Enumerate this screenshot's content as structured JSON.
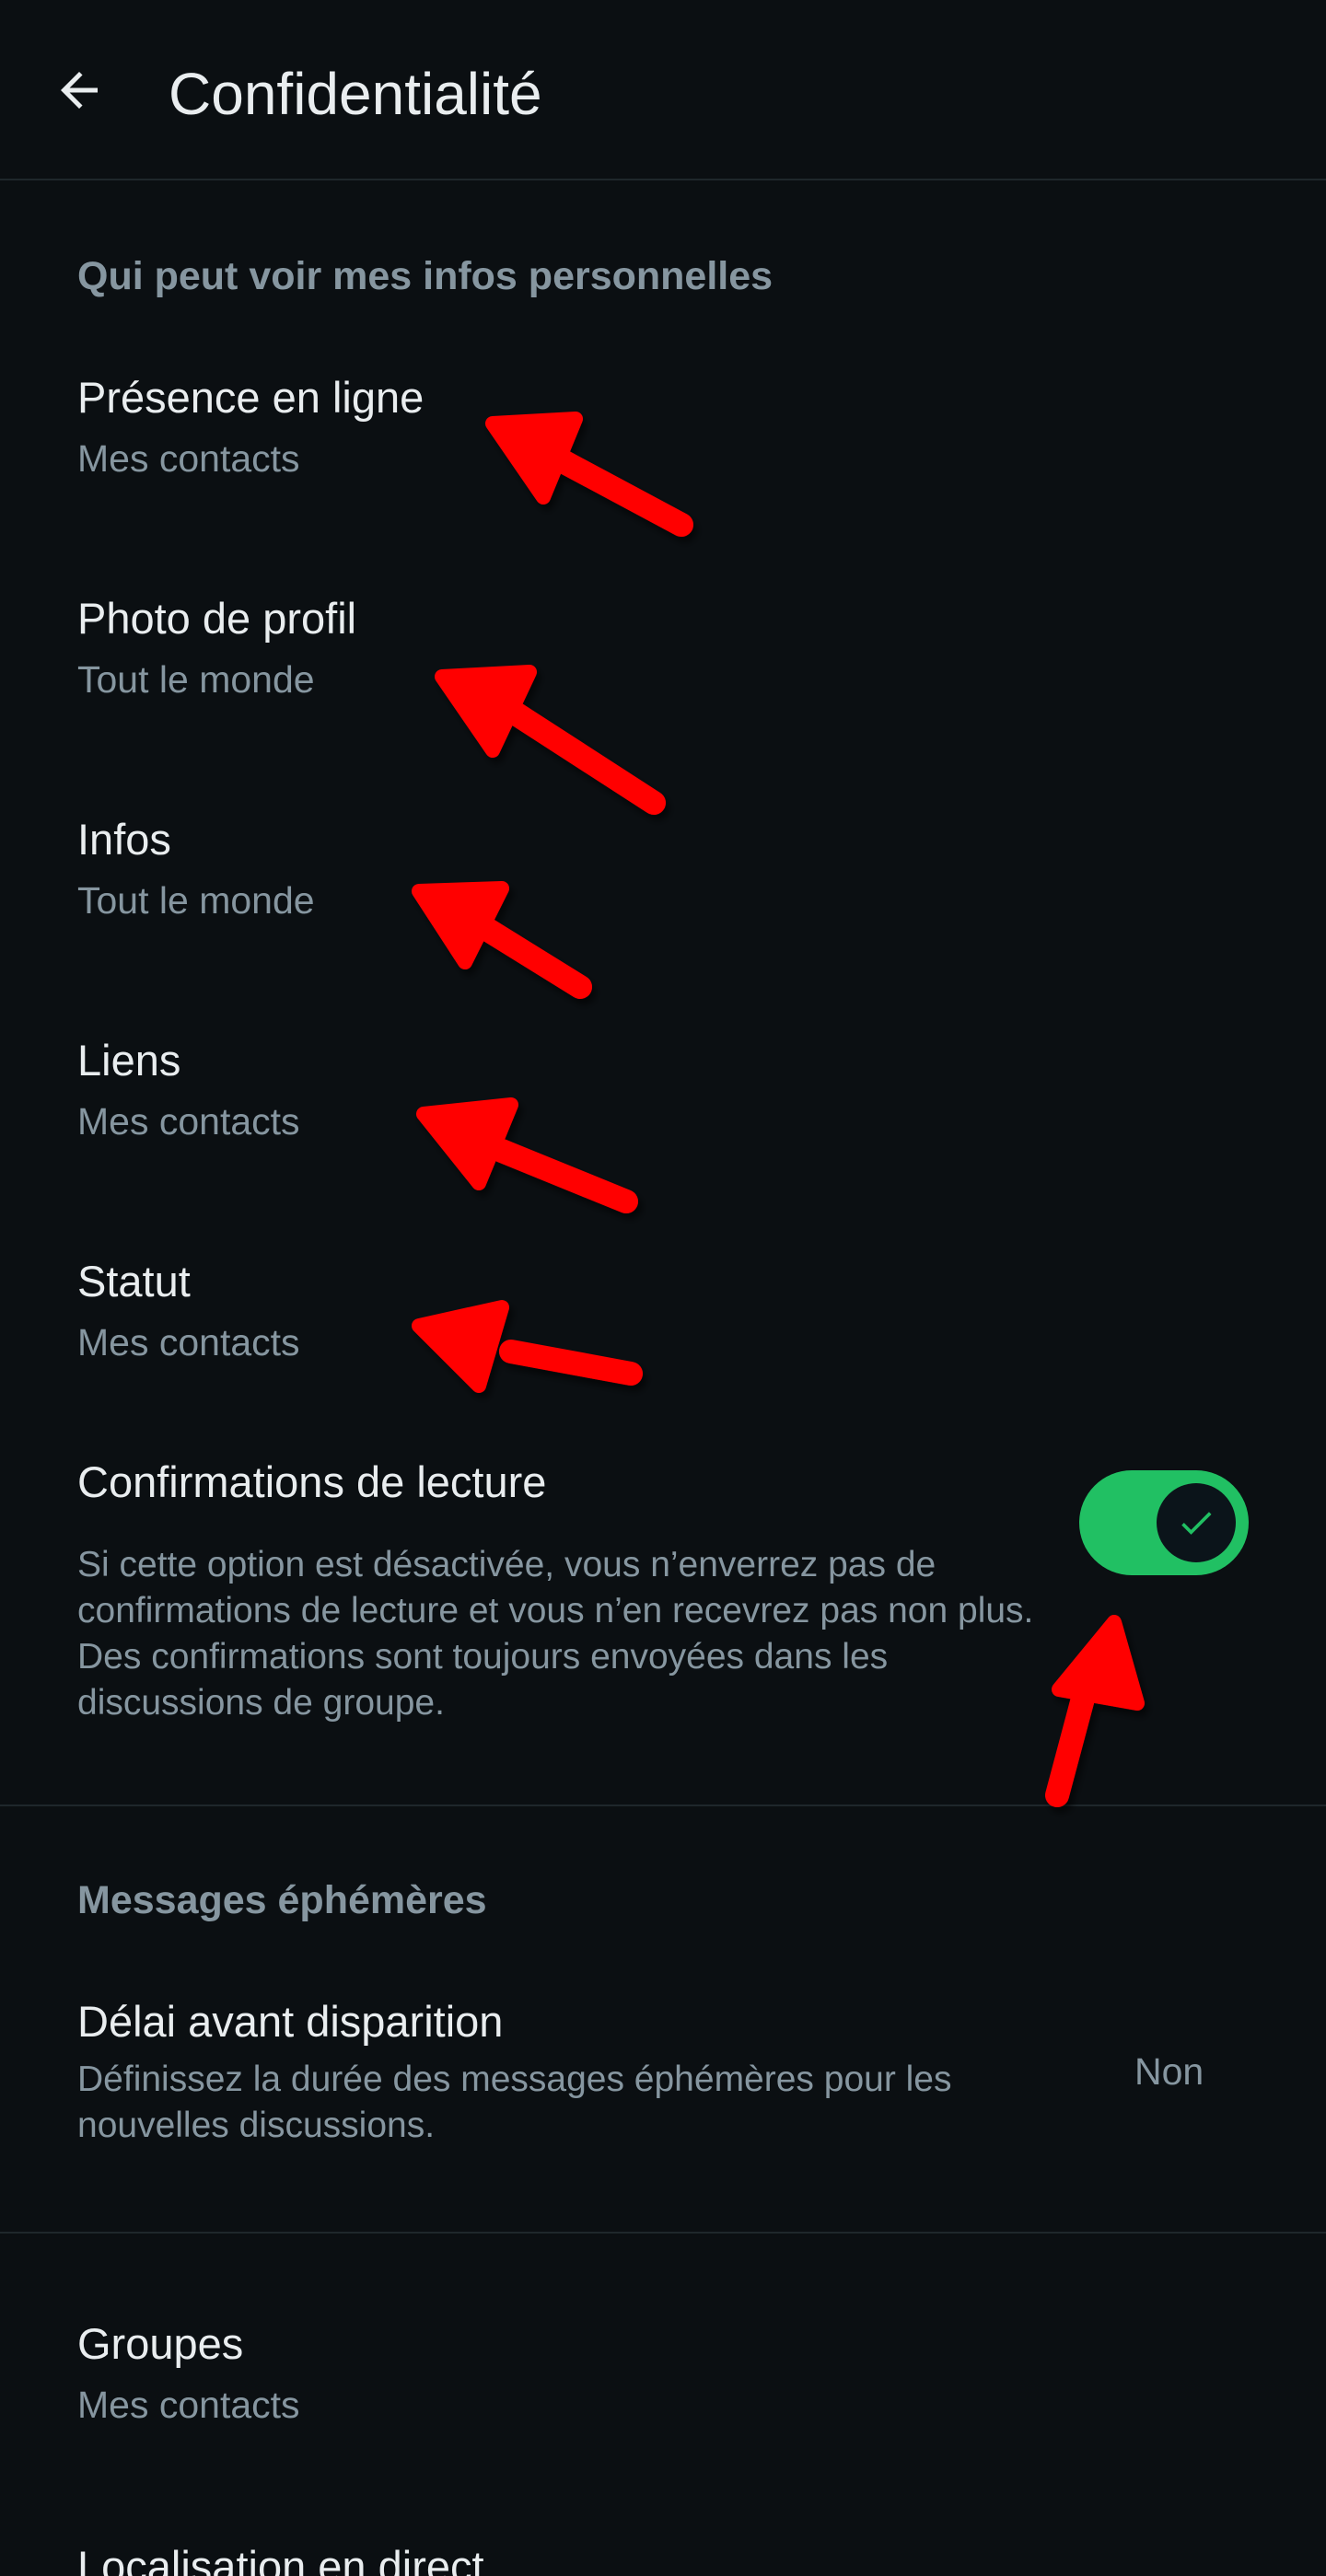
{
  "header": {
    "title": "Confidentialité",
    "back_icon": "arrow-left-icon"
  },
  "sections": {
    "personal_info_header": "Qui peut voir mes infos personnelles",
    "ephemeral_header": "Messages éphémères"
  },
  "rows": {
    "online": {
      "title": "Présence en ligne",
      "value": "Mes contacts"
    },
    "profile_photo": {
      "title": "Photo de profil",
      "value": "Tout le monde"
    },
    "about": {
      "title": "Infos",
      "value": "Tout le monde"
    },
    "links": {
      "title": "Liens",
      "value": "Mes contacts"
    },
    "status": {
      "title": "Statut",
      "value": "Mes contacts"
    },
    "read_receipts": {
      "title": "Confirmations de lecture",
      "description": "Si cette option est désactivée, vous n’enverrez pas de confirmations de lecture et vous n’en recevrez pas non plus. Des confirmations sont toujours envoyées dans les discussions de groupe.",
      "enabled": true
    },
    "default_timer": {
      "title": "Délai avant disparition",
      "description": "Définissez la durée des messages éphémères pour les nouvelles discussions.",
      "value": "Non"
    },
    "groups": {
      "title": "Groupes",
      "value": "Mes contacts"
    },
    "live_location": {
      "title": "Localisation en direct"
    }
  },
  "colors": {
    "background": "#0b0f12",
    "primary_text": "#e9edef",
    "secondary_text": "#8696a0",
    "toggle_on": "#21c063",
    "annotation_arrow": "#ff0000"
  }
}
